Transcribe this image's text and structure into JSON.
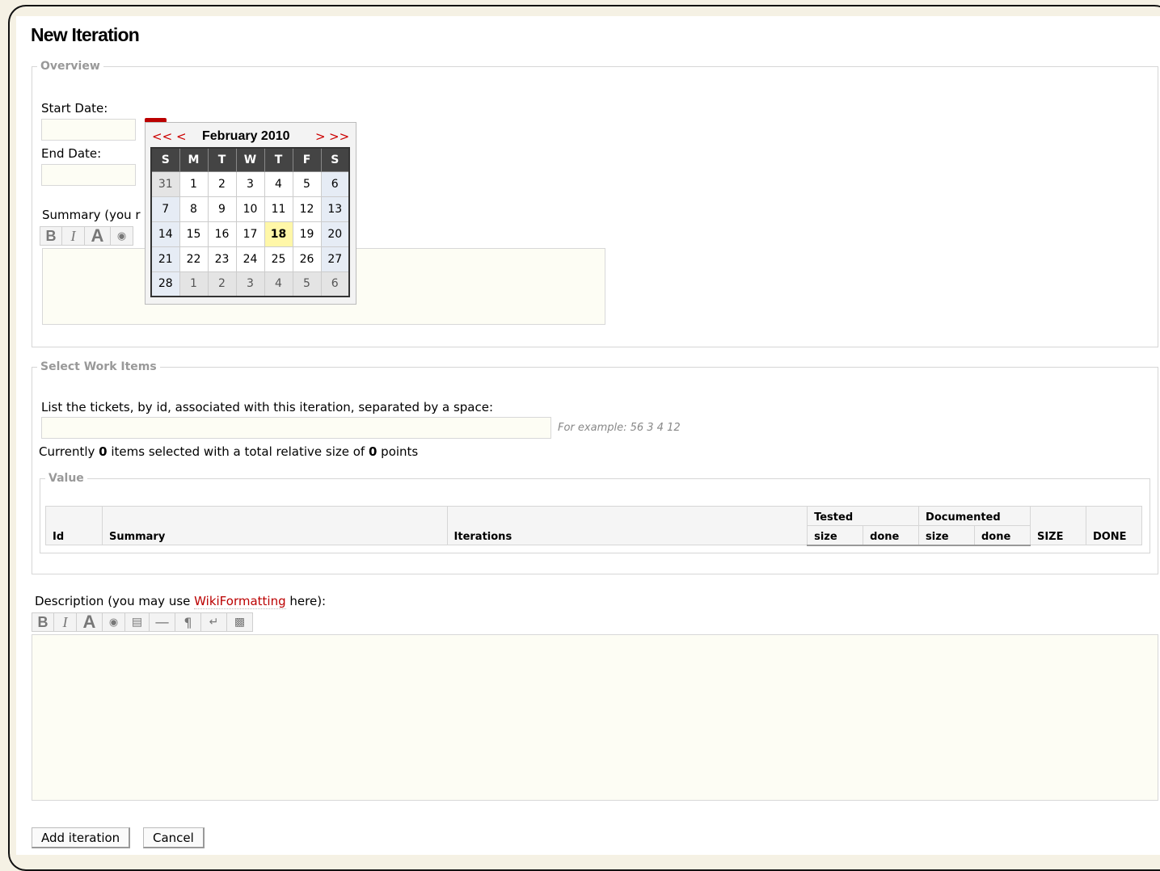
{
  "page_title": "New Iteration",
  "overview": {
    "legend": "Overview",
    "start_label": "Start Date:",
    "end_label": "End Date:",
    "summary_label": "Summary (you r",
    "start_value": "",
    "end_value": ""
  },
  "calendar": {
    "prev_year": "<<",
    "prev_month": "<",
    "month_title": "February 2010",
    "next_month": ">",
    "next_year": ">>",
    "weekdays": [
      "S",
      "M",
      "T",
      "W",
      "T",
      "F",
      "S"
    ],
    "weeks": [
      [
        "31",
        "1",
        "2",
        "3",
        "4",
        "5",
        "6"
      ],
      [
        "7",
        "8",
        "9",
        "10",
        "11",
        "12",
        "13"
      ],
      [
        "14",
        "15",
        "16",
        "17",
        "18",
        "19",
        "20"
      ],
      [
        "21",
        "22",
        "23",
        "24",
        "25",
        "26",
        "27"
      ],
      [
        "28",
        "1",
        "2",
        "3",
        "4",
        "5",
        "6"
      ]
    ],
    "today": "18"
  },
  "work_items": {
    "legend": "Select Work Items",
    "tickets_label": "List the tickets, by id, associated with this iteration, separated by a space:",
    "tickets_value": "",
    "example": "For example: 56 3 4 12",
    "currently_prefix": "Currently ",
    "item_count": "0",
    "currently_middle": " items selected with a total relative size of ",
    "point_total": "0",
    "currently_suffix": " points",
    "value_legend": "Value",
    "columns": {
      "id": "Id",
      "summary": "Summary",
      "iterations": "Iterations",
      "tested": "Tested",
      "documented": "Documented",
      "size": "size",
      "done": "done",
      "size_total": "SIZE",
      "done_total": "DONE"
    }
  },
  "description": {
    "prefix": "Description (you may use ",
    "link": "WikiFormatting",
    "suffix": " here):"
  },
  "buttons": {
    "add": "Add iteration",
    "cancel": "Cancel"
  }
}
